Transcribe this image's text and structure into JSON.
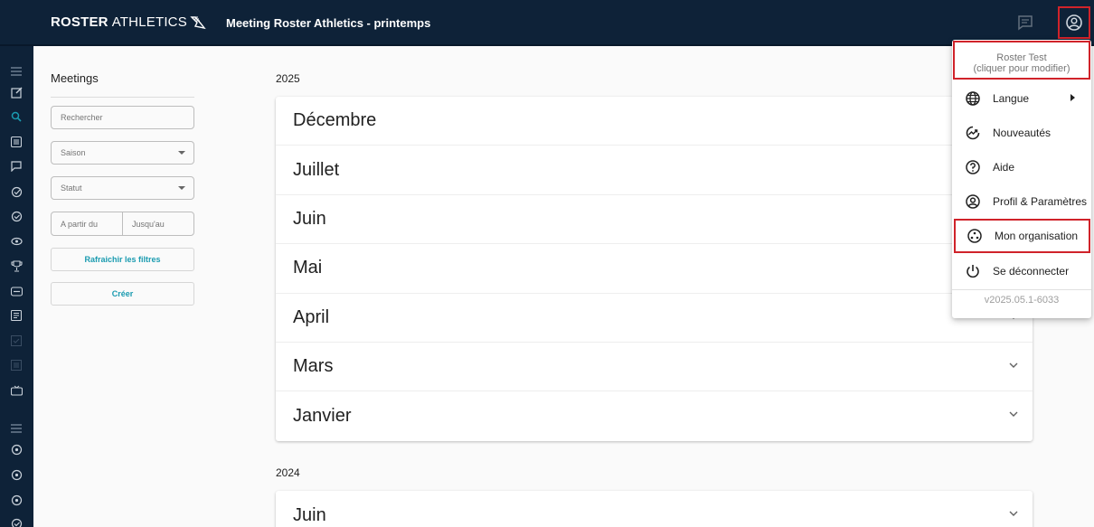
{
  "header": {
    "logo_bold": "ROSTER",
    "logo_light": "ATHLETICS",
    "title": "Meeting Roster Athletics - printemps"
  },
  "filters": {
    "title": "Meetings",
    "search_placeholder": "Rechercher",
    "season_label": "Saison",
    "status_label": "Statut",
    "date_from": "A partir du",
    "date_to": "Jusqu'au",
    "refresh_label": "Rafraichir les filtres",
    "create_label": "Créer"
  },
  "years": [
    {
      "year": "2025",
      "months": [
        "Décembre",
        "Juillet",
        "Juin",
        "Mai",
        "April",
        "Mars",
        "Janvier"
      ]
    },
    {
      "year": "2024",
      "months": [
        "Juin"
      ]
    }
  ],
  "user_menu": {
    "user_name": "Roster Test",
    "user_hint": "(cliquer pour modifier)",
    "items": [
      {
        "label": "Langue",
        "icon": "globe-icon"
      },
      {
        "label": "Nouveautés",
        "icon": "trending-icon"
      },
      {
        "label": "Aide",
        "icon": "help-icon"
      },
      {
        "label": "Profil & Paramètres",
        "icon": "account-icon"
      },
      {
        "label": "Mon organisation",
        "icon": "organisation-icon"
      },
      {
        "label": "Se déconnecter",
        "icon": "power-icon"
      }
    ],
    "version": "v2025.05.1-6033"
  },
  "colors": {
    "navbar": "#0e2238",
    "accent": "#1a9bb0",
    "highlight": "#d0232a"
  }
}
